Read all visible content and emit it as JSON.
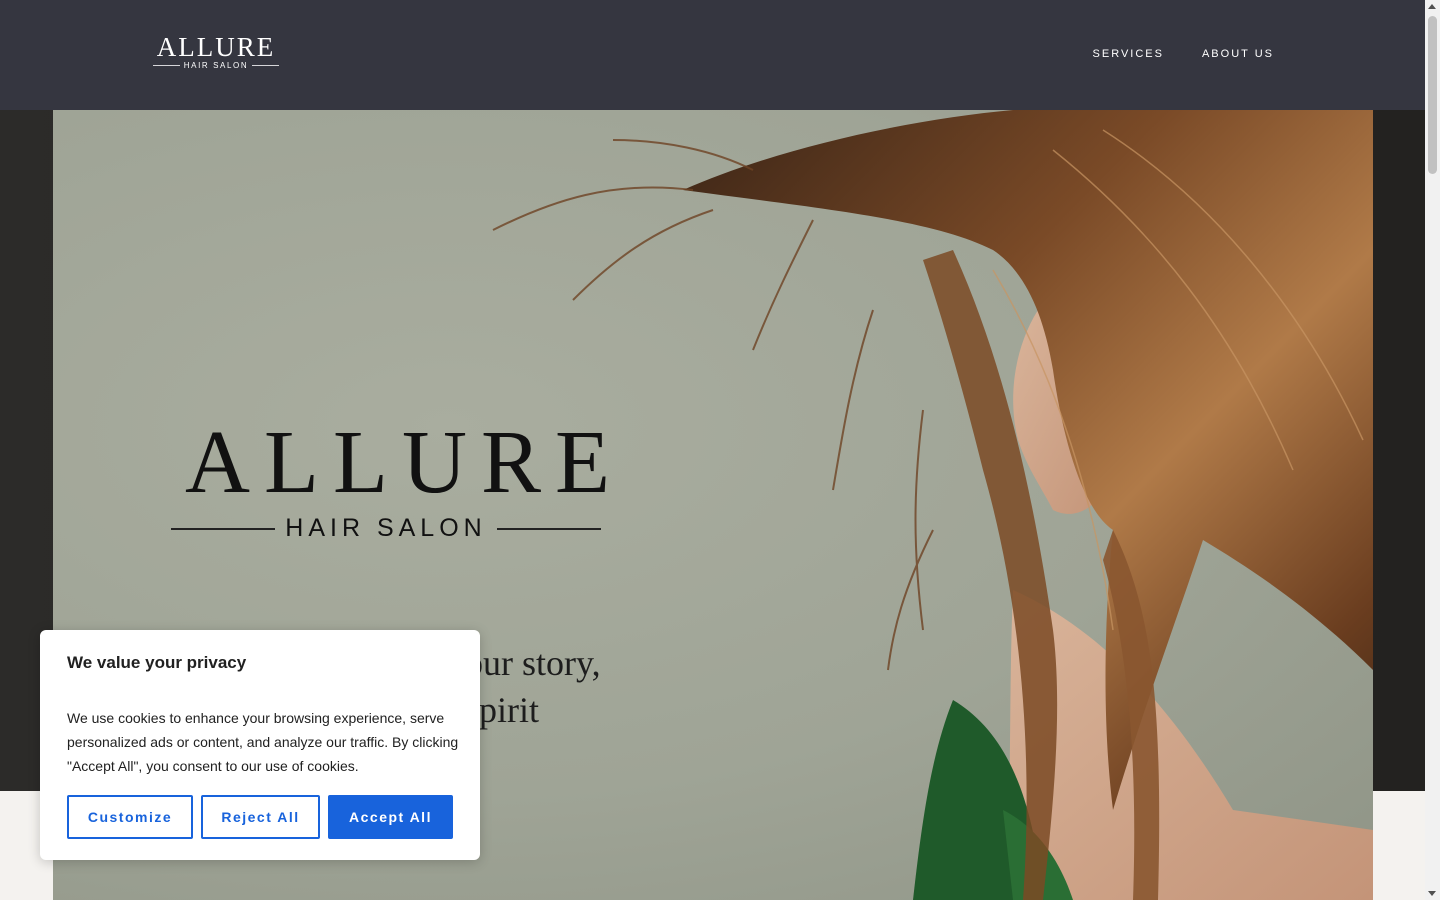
{
  "header": {
    "logo_word": "ALLURE",
    "logo_sub": "HAIR SALON",
    "nav": [
      {
        "label": "SERVICES"
      },
      {
        "label": "ABOUT US"
      }
    ]
  },
  "hero": {
    "logo_word": "ALLURE",
    "logo_sub": "HAIR SALON",
    "tagline_line1": "our story,",
    "tagline_line2": "spirit"
  },
  "cookie_banner": {
    "title": "We value your privacy",
    "body": "We use cookies to enhance your browsing experience, serve personalized ads or content, and analyze our traffic. By clicking \"Accept All\", you consent to our use of cookies.",
    "customize_label": "Customize",
    "reject_label": "Reject All",
    "accept_label": "Accept All"
  },
  "colors": {
    "header_bg": "#353640",
    "button_blue": "#1863dc",
    "hero_bg": "#a3a799"
  }
}
